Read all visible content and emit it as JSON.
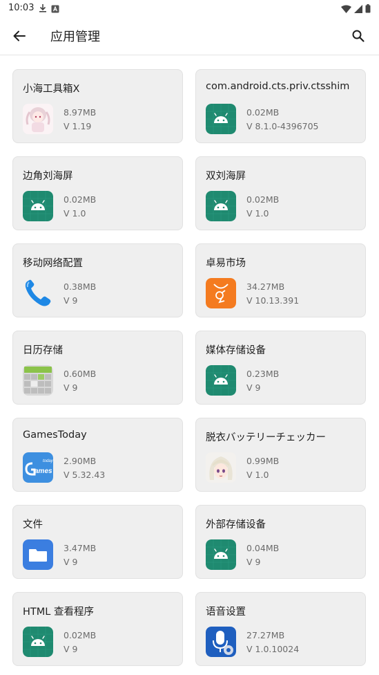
{
  "status_bar": {
    "time": "10:03",
    "left_icons": [
      "download-icon",
      "notification-a-icon"
    ],
    "right_icons": [
      "wifi-icon",
      "signal-icon",
      "battery-icon"
    ]
  },
  "header": {
    "title": "应用管理",
    "back_icon": "back-arrow-icon",
    "search_icon": "search-icon"
  },
  "apps": [
    {
      "name": "小海工具箱X",
      "size": "8.97MB",
      "version": "V 1.19",
      "icon": "anime-girl-icon"
    },
    {
      "name": "com.android.cts.priv.ctsshim",
      "size": "0.02MB",
      "version": "V 8.1.0-4396705",
      "icon": "android-icon"
    },
    {
      "name": "边角刘海屏",
      "size": "0.02MB",
      "version": "V 1.0",
      "icon": "android-icon"
    },
    {
      "name": "双刘海屏",
      "size": "0.02MB",
      "version": "V 1.0",
      "icon": "android-icon"
    },
    {
      "name": "移动网络配置",
      "size": "0.38MB",
      "version": "V 9",
      "icon": "phone-icon"
    },
    {
      "name": "卓易市场",
      "size": "34.27MB",
      "version": "V 10.13.391",
      "icon": "market-bag-icon"
    },
    {
      "name": "日历存储",
      "size": "0.60MB",
      "version": "V 9",
      "icon": "calendar-grid-icon"
    },
    {
      "name": "媒体存储设备",
      "size": "0.23MB",
      "version": "V 9",
      "icon": "android-icon"
    },
    {
      "name": "GamesToday",
      "size": "2.90MB",
      "version": "V 5.32.43",
      "icon": "games-today-icon"
    },
    {
      "name": "脱衣バッテリーチェッカー",
      "size": "0.99MB",
      "version": "V 1.0",
      "icon": "anime-face-icon"
    },
    {
      "name": "文件",
      "size": "3.47MB",
      "version": "V 9",
      "icon": "folder-icon"
    },
    {
      "name": "外部存储设备",
      "size": "0.04MB",
      "version": "V 9",
      "icon": "android-icon"
    },
    {
      "name": "HTML 查看程序",
      "size": "0.02MB",
      "version": "V 9",
      "icon": "android-icon"
    },
    {
      "name": "语音设置",
      "size": "27.27MB",
      "version": "V 1.0.10024",
      "icon": "voice-settings-icon"
    }
  ]
}
